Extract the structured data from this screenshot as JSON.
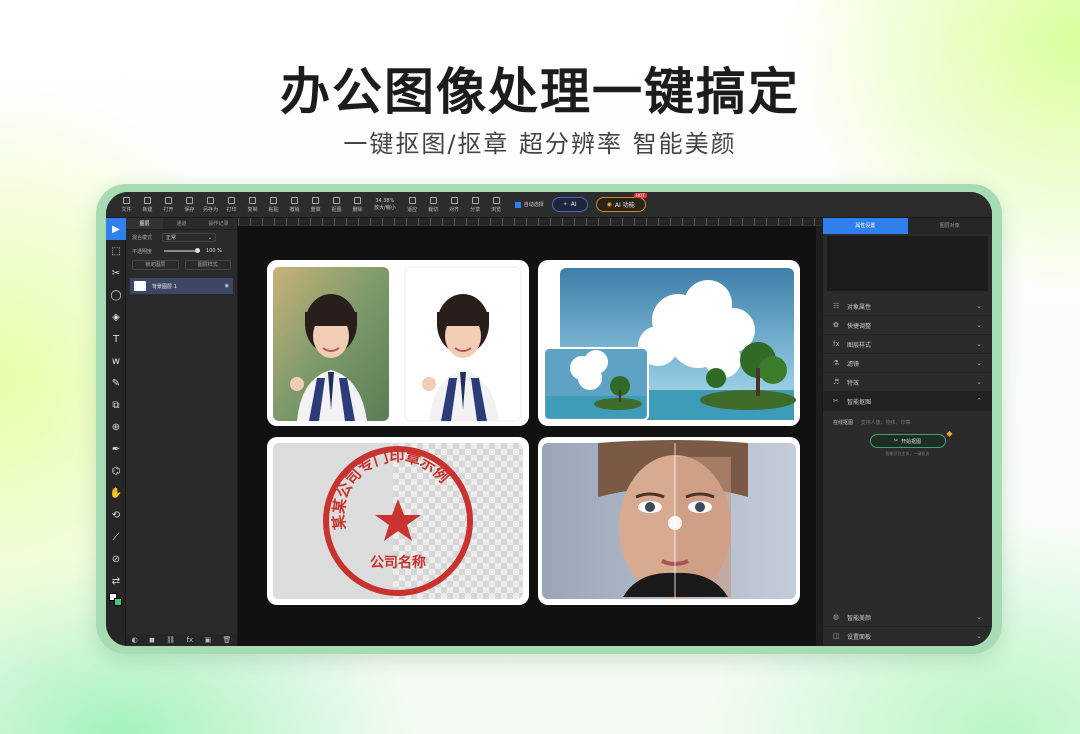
{
  "hero": {
    "title": "办公图像处理一键搞定",
    "subtitle": "一键抠图/抠章  超分辨率  智能美颜"
  },
  "toolbar": {
    "items": [
      "文件",
      "新建",
      "打开",
      "保存",
      "另存为",
      "打印",
      "复制",
      "粘贴",
      "撤销",
      "重做",
      "抠图",
      "删除"
    ],
    "items2": [
      "适应",
      "裁切",
      "对齐",
      "分享",
      "浏览"
    ],
    "zoom_value": "34.38%",
    "zoom_label": "放大/缩小",
    "auto_select_label": "自动选择",
    "ai_pill_label": "AI",
    "ai_pill2_label": "AI 功能",
    "hot_badge": "HOT"
  },
  "tools": [
    "▶",
    "⬚",
    "✂",
    "◯",
    "◈",
    "T",
    "ᴡ",
    "✎",
    "⧉",
    "⊕",
    "✒",
    "⌬",
    "✋",
    "⟲",
    "⟋",
    "⊘",
    "⇄"
  ],
  "layers_panel": {
    "tabs": [
      "图层",
      "通道",
      "操作记录"
    ],
    "blend_label": "混合模式",
    "blend_value": "正常",
    "opacity_label": "不透明度",
    "opacity_value": "100 %",
    "button_left": "锁定图层",
    "button_right": "图层样式",
    "layer_name": "背景图层 1",
    "bottom_icons": [
      "◐",
      "◼",
      "⛓",
      "fx",
      "▣",
      "🗑"
    ]
  },
  "props_panel": {
    "tabs": [
      "属性设置",
      "图层对象"
    ],
    "sections": [
      {
        "icon": "☷",
        "label": "对象属性"
      },
      {
        "icon": "✿",
        "label": "快捷调整"
      },
      {
        "icon": "fx",
        "label": "图层样式"
      },
      {
        "icon": "⚗",
        "label": "滤镜"
      },
      {
        "icon": "♬",
        "label": "特效"
      }
    ],
    "smart_section": {
      "icon": "✂",
      "label": "智能抠图"
    },
    "smart_body_label": "在线抠图",
    "smart_desc": "支持人像、物体、印章",
    "smart_button": "开始抠图",
    "smart_tip": "智能识别主体，一键抠出",
    "bottom_sections": [
      {
        "icon": "◍",
        "label": "智能美颜"
      },
      {
        "icon": "◫",
        "label": "设置面板"
      }
    ]
  },
  "stamp": {
    "arc_text": "某某公司专门印章示例",
    "bottom_text": "公司名称"
  },
  "colors": {
    "accent": "#2f80ed",
    "frame": "#a6dcb4",
    "stamp_red": "#c9332f"
  }
}
